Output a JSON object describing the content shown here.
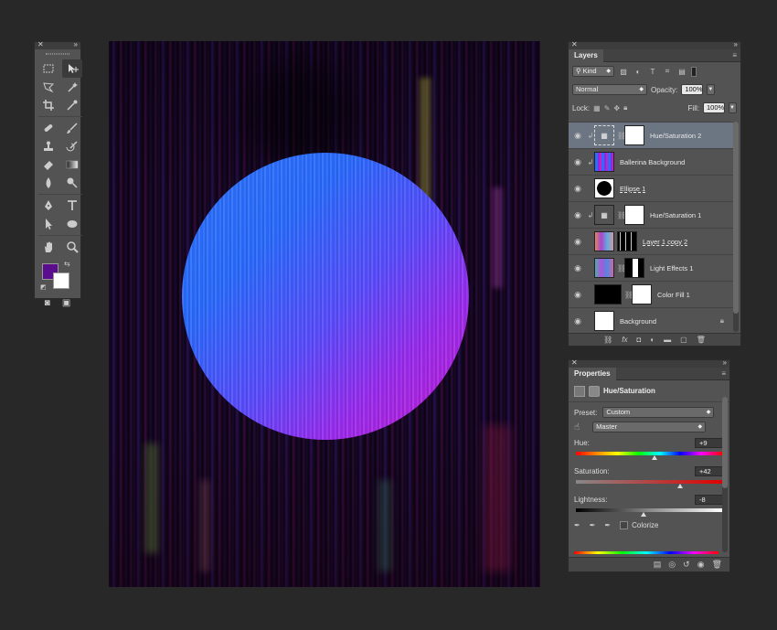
{
  "layers_panel": {
    "tab": "Layers",
    "kind_filter": "Kind",
    "blend_mode": "Normal",
    "opacity_label": "Opacity:",
    "opacity_value": "100%",
    "lock_label": "Lock:",
    "fill_label": "Fill:",
    "fill_value": "100%",
    "layers": [
      {
        "name": "Hue/Saturation 2",
        "selected": true
      },
      {
        "name": "Ballerina Background"
      },
      {
        "name": "Ellipse 1"
      },
      {
        "name": "Hue/Saturation 1"
      },
      {
        "name": "Layer 1 copy 2"
      },
      {
        "name": "Light Effects 1"
      },
      {
        "name": "Color Fill 1"
      },
      {
        "name": "Background"
      }
    ]
  },
  "properties_panel": {
    "tab": "Properties",
    "title": "Hue/Saturation",
    "preset_label": "Preset:",
    "preset_value": "Custom",
    "channel_value": "Master",
    "hue_label": "Hue:",
    "hue_value": "+9",
    "saturation_label": "Saturation:",
    "saturation_value": "+42",
    "lightness_label": "Lightness:",
    "lightness_value": "-8",
    "colorize_label": "Colorize"
  },
  "tools": {
    "foreground_color": "#5a0d8c",
    "background_color": "#ffffff"
  }
}
